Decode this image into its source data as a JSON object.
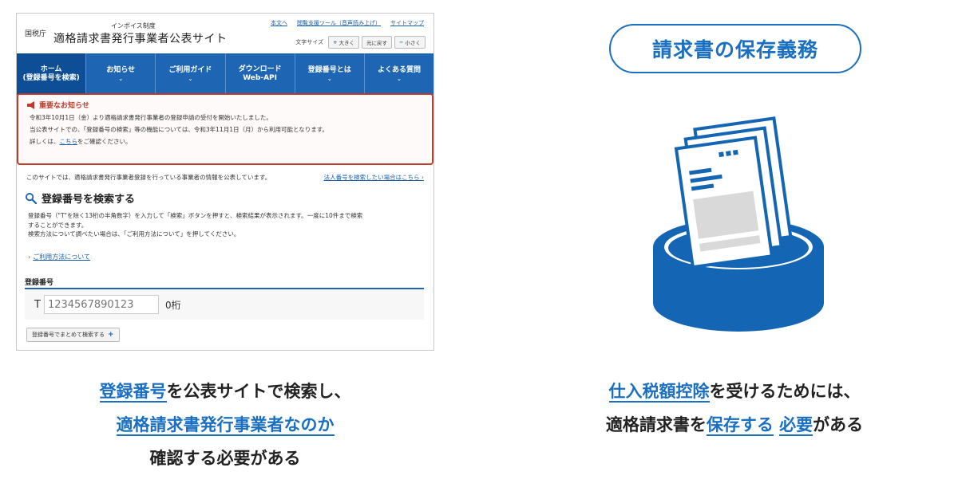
{
  "site": {
    "agency": "国税庁",
    "logo_sub": "インボイス制度",
    "logo_title": "適格請求書発行事業者公表サイト",
    "util_links": [
      "本文へ",
      "閲覧支援ツール（音声読み上げ）",
      "サイトマップ"
    ],
    "font_size_label": "文字サイズ",
    "font_buttons": [
      {
        "glyph": "+",
        "label": "大きく"
      },
      {
        "glyph": "",
        "label": "元に戻す"
      },
      {
        "glyph": "−",
        "label": "小さく"
      }
    ],
    "nav": [
      {
        "line1": "ホーム",
        "line2": "(登録番号を検索)"
      },
      {
        "line1": "お知らせ",
        "line2": ""
      },
      {
        "line1": "ご利用ガイド",
        "line2": ""
      },
      {
        "line1": "ダウンロード",
        "line2": "Web-API"
      },
      {
        "line1": "登録番号とは",
        "line2": ""
      },
      {
        "line1": "よくある質問",
        "line2": ""
      }
    ],
    "notice": {
      "title": "重要なお知らせ",
      "line1": "令和3年10月1日（金）より適格請求書発行事業者の登録申請の受付を開始いたしました。",
      "line2": "当公表サイトでの、「登録番号の検索」等の機能については、令和3年11月1日（月）から利用可能となります。",
      "line3_pre": "詳しくは、",
      "line3_link": "こちら",
      "line3_post": "をご確認ください。"
    },
    "intro_text": "このサイトでは、適格請求書発行事業者登録を行っている事業者の情報を公表しています。",
    "intro_link": "法人番号を検索したい場合はこちら ›",
    "section_title": "登録番号を検索する",
    "desc_line1": "登録番号（\"T\"を除く13桁の半角数字）を入力して「検索」ボタンを押すと、検索結果が表示されます。一度に10件まで検索",
    "desc_line2": "することができます。",
    "desc_line3": "検索方法について調べたい場合は、「ご利用方法について」を押してください。",
    "usage_link": "ご利用方法について",
    "reg_label": "登録番号",
    "reg_prefix": "T",
    "reg_placeholder": "1234567890123",
    "reg_digits": "0桁",
    "bulk_button": "登録番号でまとめて検索する"
  },
  "caption_left": {
    "l1_hl": "登録番号",
    "l1_rest": "を公表サイトで検索し、",
    "l2_hl": "適格請求書発行事業者なのか",
    "l3": "確認する必要がある"
  },
  "pill_title": "請求書の保存義務",
  "caption_right": {
    "l1_hl": "仕入税額控除",
    "l1_rest": "を受けるためには、",
    "l2_pre": "適格請求書を",
    "l2_hl1": "保存する",
    "l2_mid": " ",
    "l2_hl2": "必要",
    "l2_post": "がある"
  },
  "colors": {
    "brand_blue": "#1e66b3",
    "accent_blue": "#1a6fc0",
    "alert_red": "#c03b2b"
  }
}
